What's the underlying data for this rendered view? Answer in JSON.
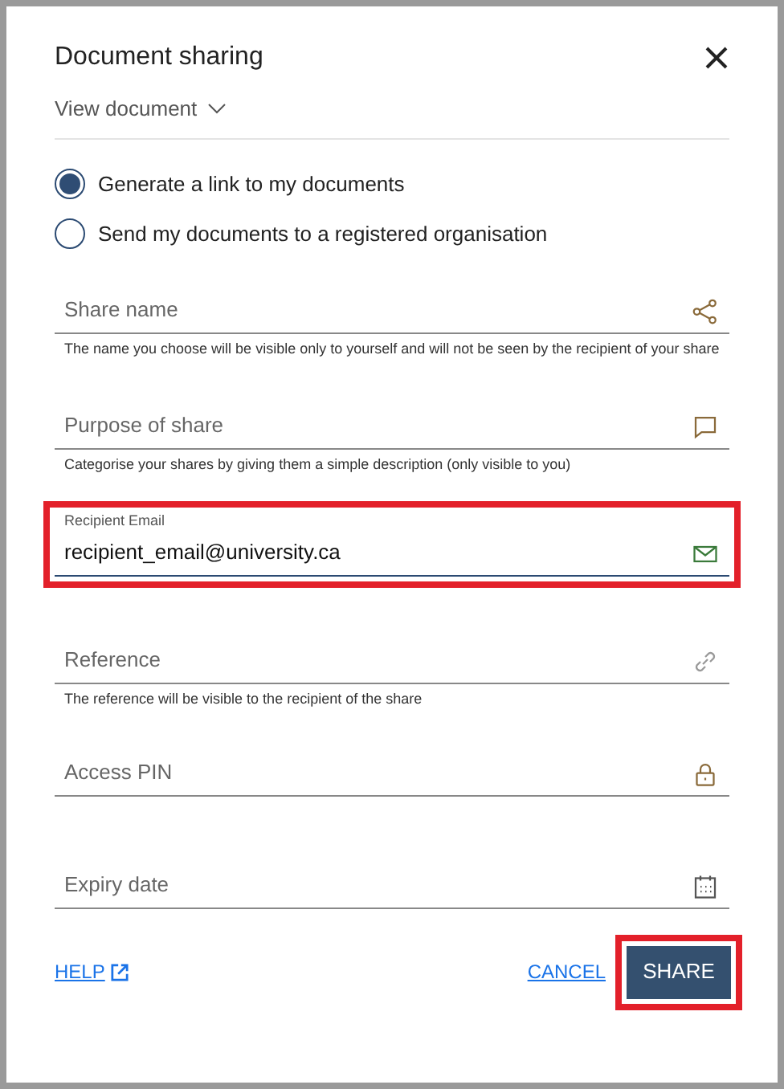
{
  "dialog": {
    "title": "Document sharing",
    "view_toggle": "View document"
  },
  "options": [
    {
      "label": "Generate a link to my documents",
      "selected": true
    },
    {
      "label": "Send my documents to a registered organisation",
      "selected": false
    }
  ],
  "fields": [
    {
      "placeholder": "Share name",
      "kind": "share",
      "helper": "The name you choose will be visible only to yourself and will not be seen by the recipient of your share",
      "highlighted": false
    },
    {
      "placeholder": "Purpose of share",
      "kind": "comment",
      "helper": "Categorise your shares by giving them a simple description (only visible to you)",
      "highlighted": false
    },
    {
      "label": "Recipient Email",
      "value": "recipient_email@university.ca",
      "kind": "mail",
      "highlighted": true
    },
    {
      "placeholder": "Reference",
      "kind": "link",
      "helper": "The reference will be visible to the recipient of the share",
      "highlighted": false
    },
    {
      "placeholder": "Access PIN",
      "kind": "lock",
      "highlighted": false
    },
    {
      "placeholder": "Expiry date",
      "kind": "calendar",
      "highlighted": false
    }
  ],
  "footer": {
    "help": "HELP",
    "cancel": "CANCEL",
    "share": "SHARE",
    "share_highlighted": true
  }
}
